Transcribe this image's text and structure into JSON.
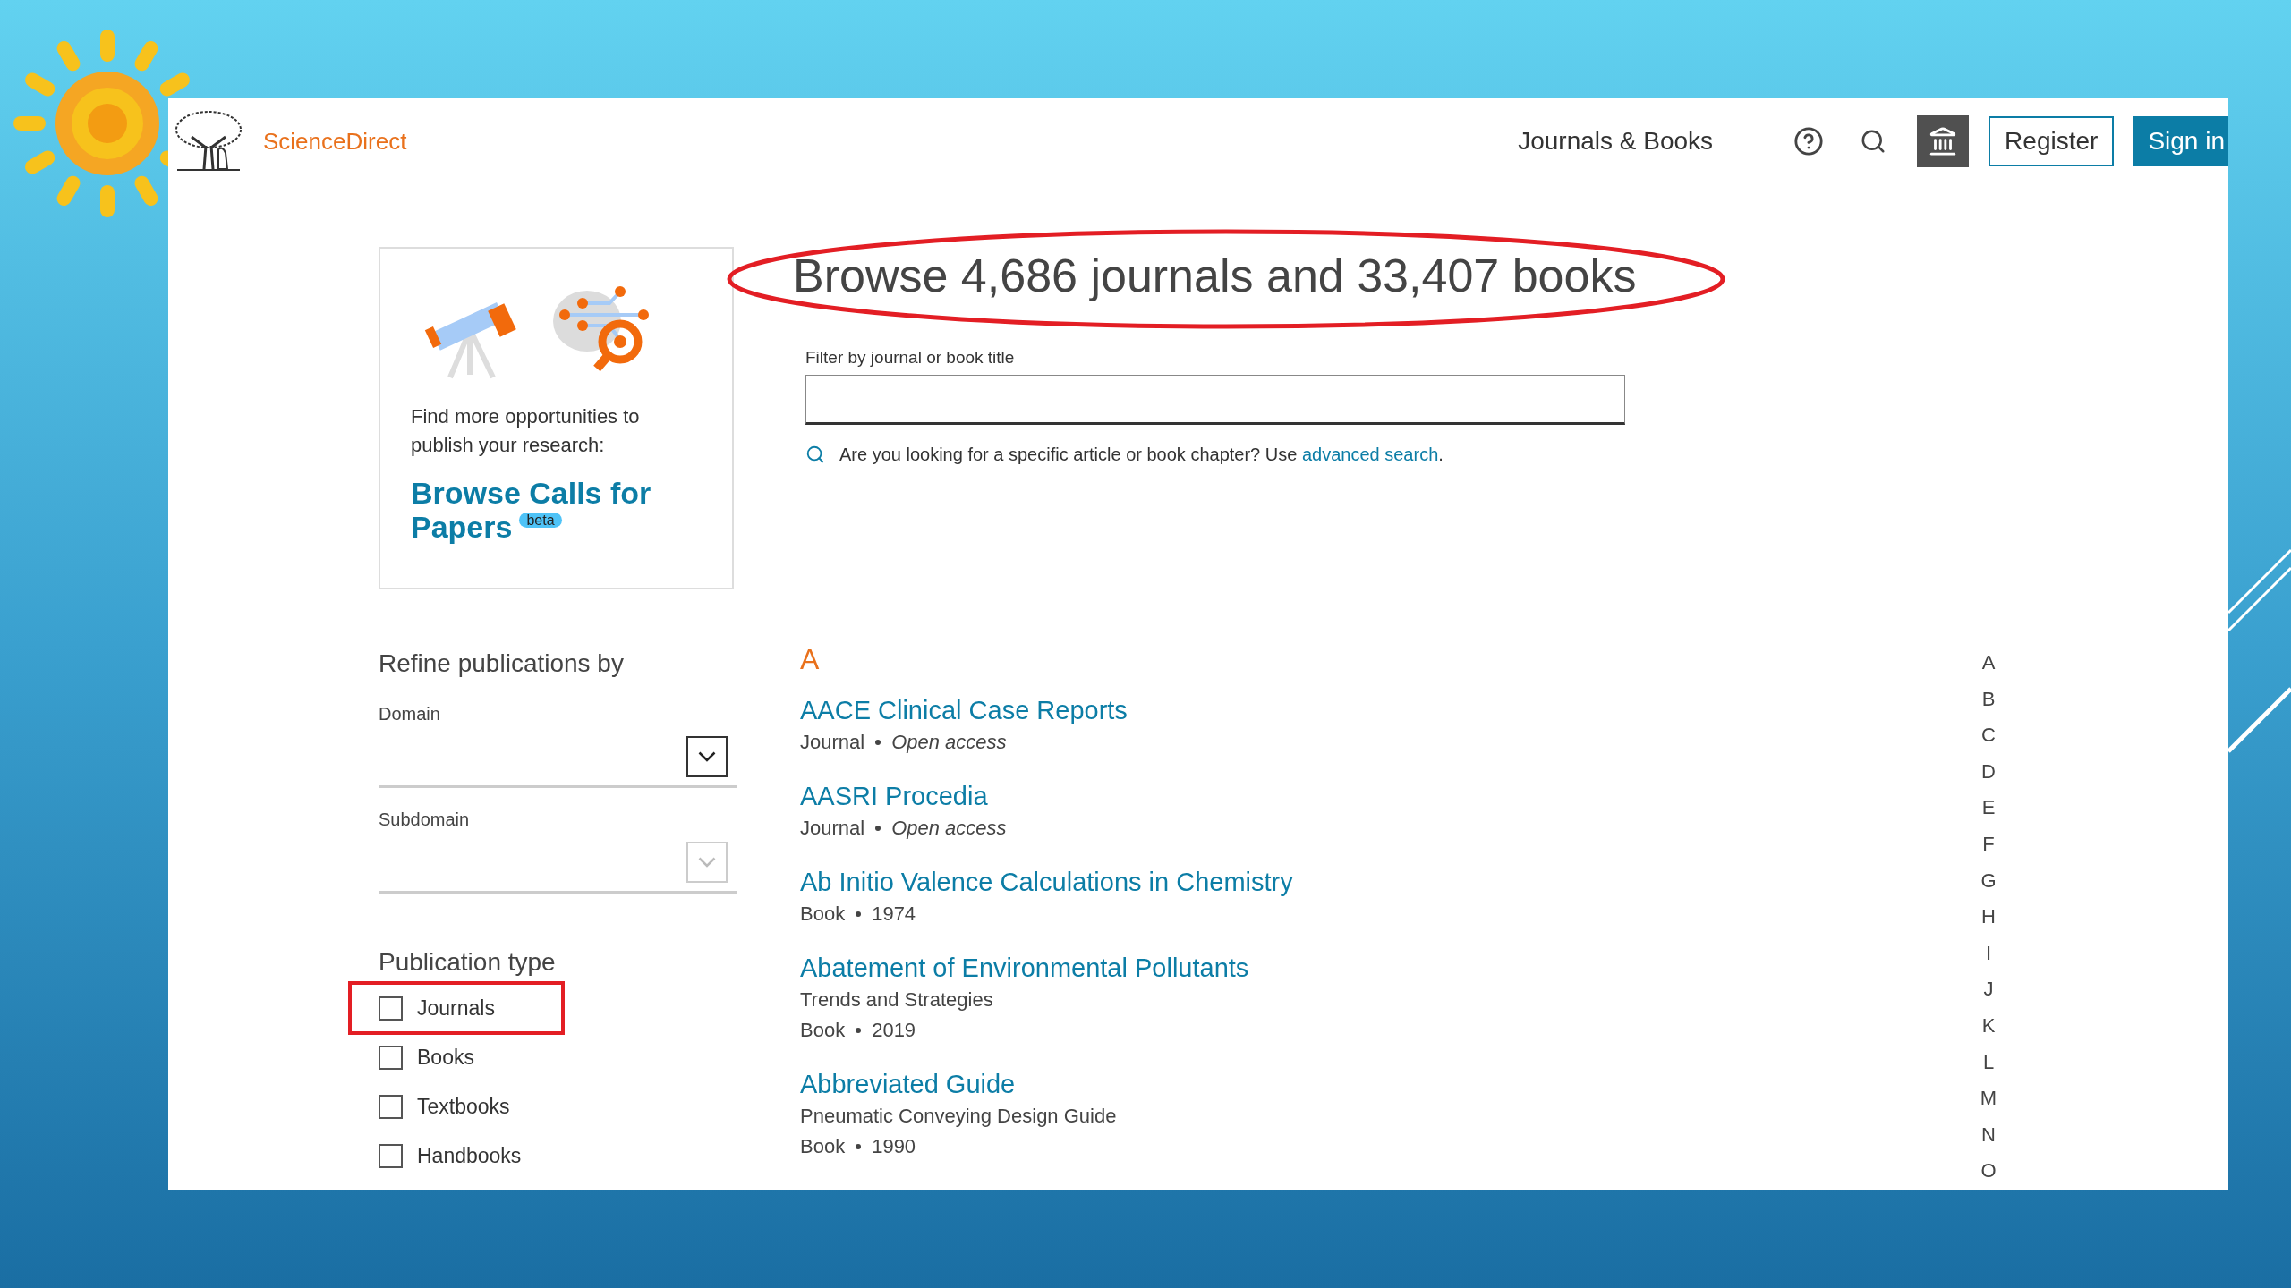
{
  "header": {
    "brand": "ScienceDirect",
    "nav": "Journals & Books",
    "register": "Register",
    "sign_in": "Sign in"
  },
  "promo": {
    "text": "Find more opportunities to publish your research:",
    "link": "Browse Calls for Papers",
    "badge": "beta"
  },
  "title": "Browse 4,686 journals and 33,407 books",
  "filter": {
    "label": "Filter by journal or book title",
    "hint": "Are you looking for a specific article or book chapter? Use ",
    "link": "advanced search",
    "after": "."
  },
  "refine": {
    "title": "Refine publications by",
    "dropdowns": [
      {
        "label": "Domain",
        "disabled": false
      },
      {
        "label": "Subdomain",
        "disabled": true
      }
    ]
  },
  "publication_type": {
    "title": "Publication type",
    "options": [
      {
        "label": "Journals",
        "checked": false,
        "highlighted": true
      },
      {
        "label": "Books",
        "checked": false,
        "highlighted": false
      },
      {
        "label": "Textbooks",
        "checked": false,
        "highlighted": false
      },
      {
        "label": "Handbooks",
        "checked": false,
        "highlighted": false
      }
    ]
  },
  "results": {
    "letter": "A",
    "items": [
      {
        "title": "AACE Clinical Case Reports",
        "kind": "journal",
        "type": "Journal",
        "detail": "Open access"
      },
      {
        "title": "AASRI Procedia",
        "kind": "journal",
        "type": "Journal",
        "detail": "Open access"
      },
      {
        "title": "Ab Initio Valence Calculations in Chemistry",
        "kind": "book",
        "type": "Book",
        "detail": "1974"
      },
      {
        "title": "Abatement of Environmental Pollutants",
        "subtitle": "Trends and Strategies",
        "kind": "book",
        "type": "Book",
        "detail": "2019"
      },
      {
        "title": "Abbreviated Guide",
        "subtitle": "Pneumatic Conveying Design Guide",
        "kind": "book",
        "type": "Book",
        "detail": "1990"
      }
    ]
  },
  "alphabet": [
    "A",
    "B",
    "C",
    "D",
    "E",
    "F",
    "G",
    "H",
    "I",
    "J",
    "K",
    "L",
    "M",
    "N",
    "O"
  ]
}
